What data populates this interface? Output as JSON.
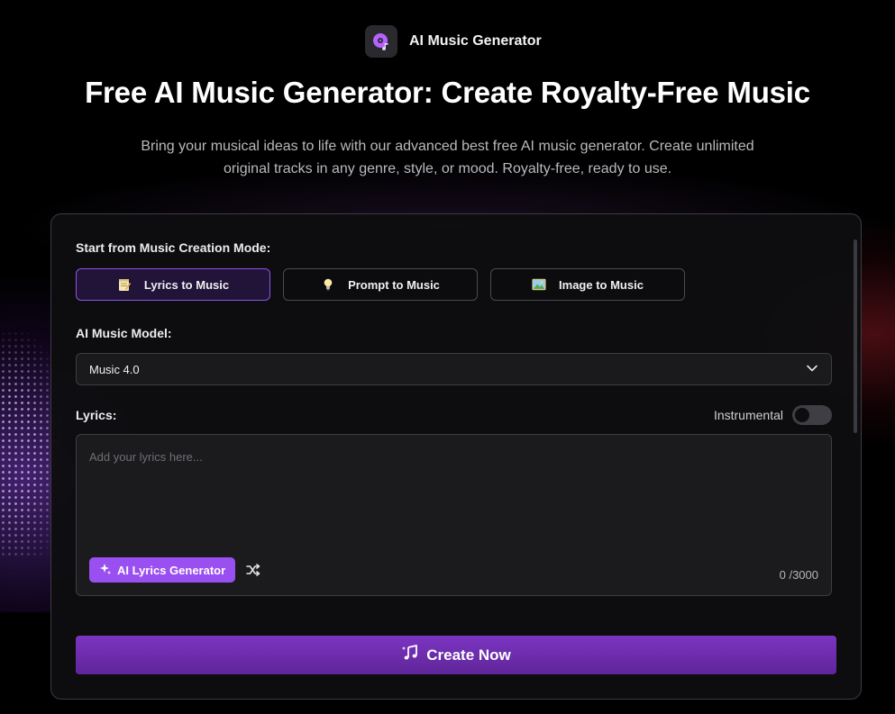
{
  "brand": {
    "name": "AI Music Generator",
    "logo_icon": "music-disc-icon",
    "accent": "#b463ff"
  },
  "hero": {
    "title": "Free AI Music Generator: Create Royalty-Free Music",
    "subtitle_line1": "Bring your musical ideas to life with our advanced best free AI music generator. Create unlimited",
    "subtitle_line2": "original tracks in any genre, style, or mood. Royalty-free, ready to use."
  },
  "form": {
    "mode_label": "Start from Music Creation Mode:",
    "modes": [
      {
        "label": "Lyrics to Music",
        "icon": "notepad-icon",
        "active": true
      },
      {
        "label": "Prompt to Music",
        "icon": "lightbulb-icon",
        "active": false
      },
      {
        "label": "Image to Music",
        "icon": "picture-icon",
        "active": false
      }
    ],
    "model_label": "AI Music Model:",
    "model_value": "Music 4.0",
    "lyrics_label": "Lyrics:",
    "instrumental_label": "Instrumental",
    "instrumental_on": false,
    "lyrics_placeholder": "Add your lyrics here...",
    "ai_lyrics_button": "AI Lyrics Generator",
    "char_count": "0 /3000",
    "create_button": "Create Now"
  },
  "colors": {
    "active_mode_border": "#8a55e6",
    "ai_button": "#9a4ff0",
    "create_gradient_top": "#7b35c2",
    "create_gradient_bottom": "#5f2598"
  }
}
